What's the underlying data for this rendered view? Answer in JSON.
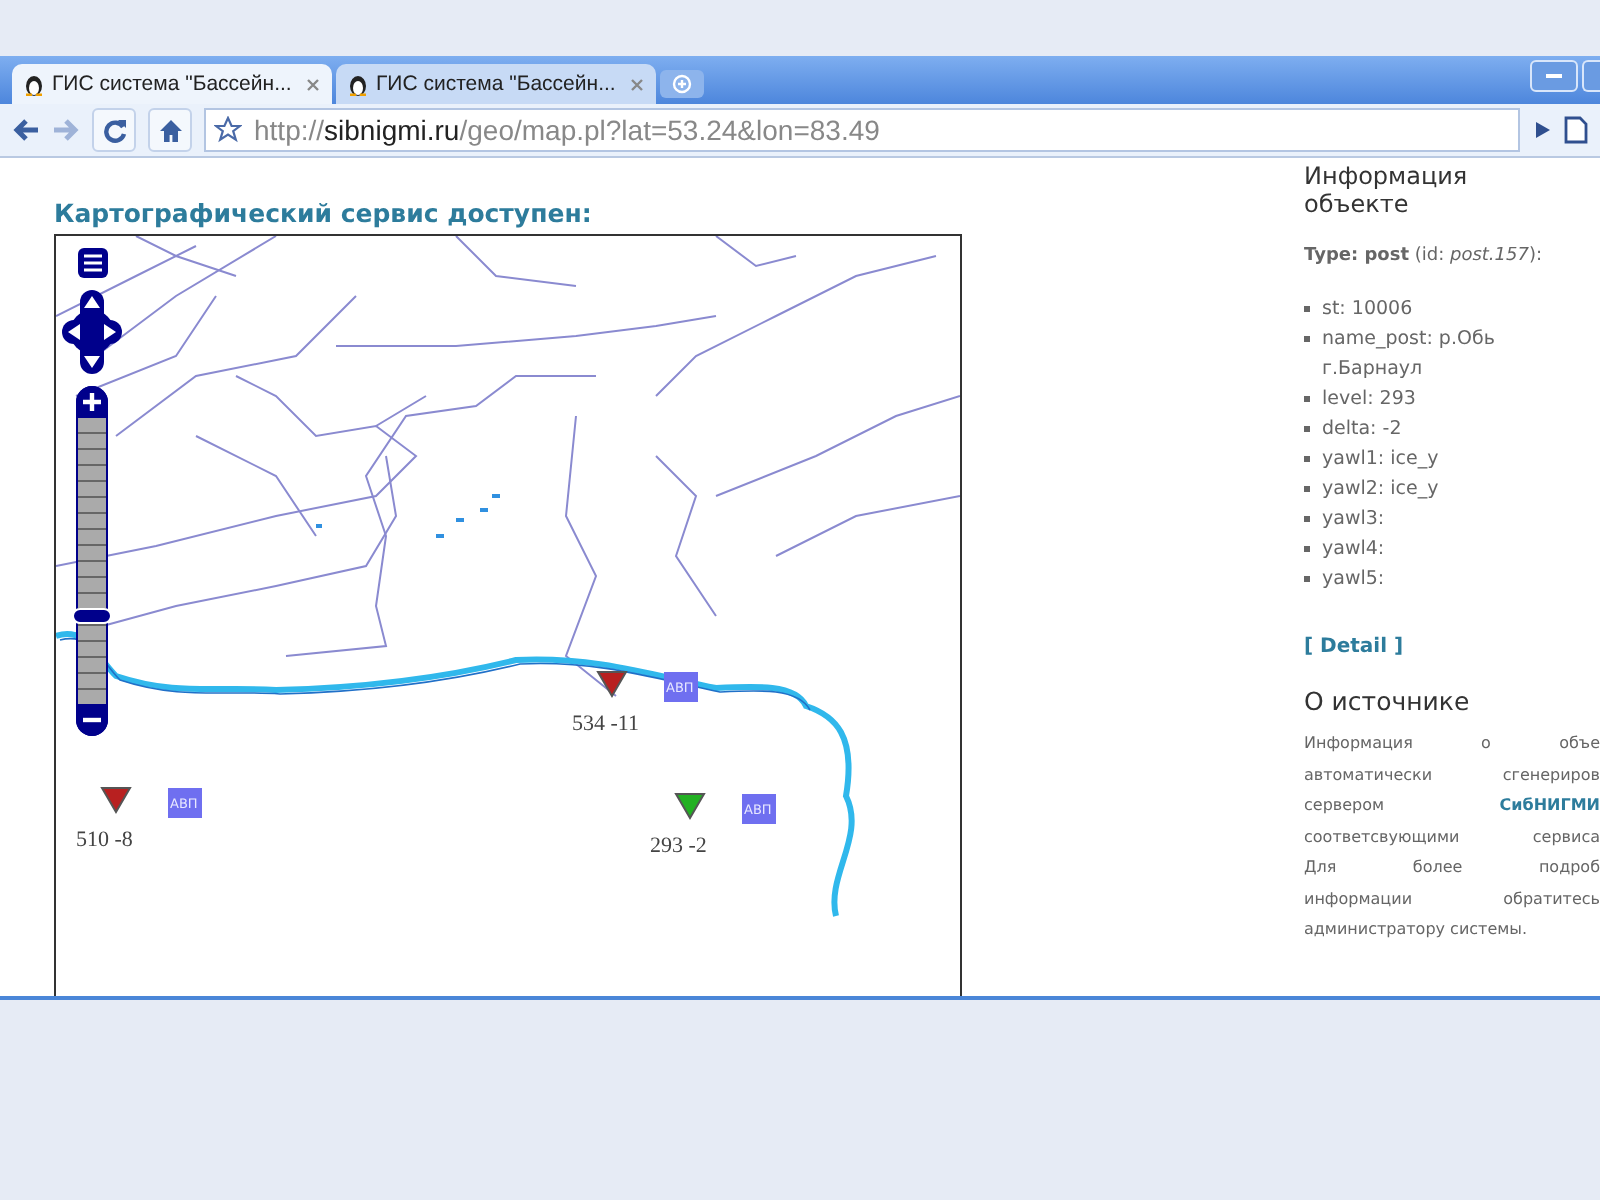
{
  "browser": {
    "tabs": [
      {
        "title": "ГИС система \"Бассейн...",
        "selected": true
      },
      {
        "title": "ГИС система \"Бассейн...",
        "selected": false
      }
    ],
    "address": {
      "scheme": "http://",
      "host": "sibnigmi.ru",
      "path": "/geo/map.pl?lat=53.24&lon=83.49"
    }
  },
  "page": {
    "heading": "Картографический сервис доступен:",
    "map": {
      "zoom": {
        "level": 0.31
      },
      "markers": [
        {
          "value": "534",
          "delta": "-11",
          "color": "#b82020",
          "tag": "АВП"
        },
        {
          "value": "510",
          "delta": "-8",
          "color": "#b82020",
          "tag": "АВП"
        },
        {
          "value": "293",
          "delta": "-2",
          "color": "#22b022",
          "tag": "АВП"
        }
      ]
    },
    "info": {
      "title": "Информация объекте",
      "type_line": "**Type: post** (id: *post.157*):",
      "fields": [
        "st: 10006",
        "name_post: р.Обь г.Барнаул",
        "level: 293",
        "delta: -2",
        "yawl1: ice_y",
        "yawl2: ice_y",
        "yawl3:",
        "yawl4:",
        "yawl5:"
      ],
      "detail_link": "[ Detail ]",
      "source_title": "О источнике",
      "source_lines": [
        "Информация о объе",
        "автоматически сгенериров",
        "сервером **СибНИГМИ**",
        "соответсвующими сервиса",
        "Для более подроб",
        "информации обратитесь",
        "администратору системы."
      ]
    }
  }
}
